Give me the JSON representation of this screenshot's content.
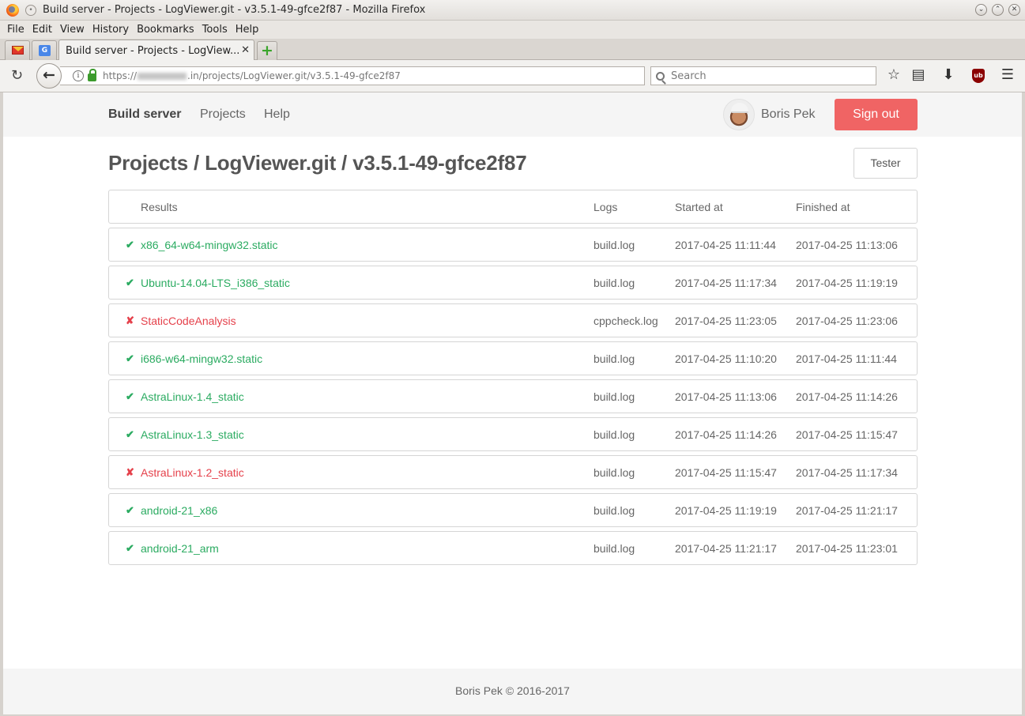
{
  "window": {
    "title": "Build server - Projects - LogViewer.git - v3.5.1-49-gfce2f87 - Mozilla Firefox"
  },
  "menu": [
    "File",
    "Edit",
    "View",
    "History",
    "Bookmarks",
    "Tools",
    "Help"
  ],
  "tabs": {
    "active_title": "Build server - Projects - LogView...",
    "close_glyph": "✕",
    "new_tab_glyph": "+"
  },
  "urlbar": {
    "prefix": "https://",
    "suffix": ".in/projects/LogViewer.git/v3.5.1-49-gfce2f87"
  },
  "search": {
    "placeholder": "Search"
  },
  "site": {
    "brand": "Build server",
    "nav": [
      "Projects",
      "Help"
    ],
    "user": "Boris Pek",
    "signout_label": "Sign out"
  },
  "page": {
    "title": "Projects / LogViewer.git / v3.5.1-49-gfce2f87",
    "tester_label": "Tester"
  },
  "table": {
    "headers": [
      "Results",
      "Logs",
      "Started at",
      "Finished at"
    ],
    "rows": [
      {
        "status": "ok",
        "mark": "✔",
        "name": "x86_64-w64-mingw32.static",
        "log": "build.log",
        "started": "2017-04-25 11:11:44",
        "finished": "2017-04-25 11:13:06"
      },
      {
        "status": "ok",
        "mark": "✔",
        "name": "Ubuntu-14.04-LTS_i386_static",
        "log": "build.log",
        "started": "2017-04-25 11:17:34",
        "finished": "2017-04-25 11:19:19"
      },
      {
        "status": "fail",
        "mark": "✘",
        "name": "StaticCodeAnalysis",
        "log": "cppcheck.log",
        "started": "2017-04-25 11:23:05",
        "finished": "2017-04-25 11:23:06"
      },
      {
        "status": "ok",
        "mark": "✔",
        "name": "i686-w64-mingw32.static",
        "log": "build.log",
        "started": "2017-04-25 11:10:20",
        "finished": "2017-04-25 11:11:44"
      },
      {
        "status": "ok",
        "mark": "✔",
        "name": "AstraLinux-1.4_static",
        "log": "build.log",
        "started": "2017-04-25 11:13:06",
        "finished": "2017-04-25 11:14:26"
      },
      {
        "status": "ok",
        "mark": "✔",
        "name": "AstraLinux-1.3_static",
        "log": "build.log",
        "started": "2017-04-25 11:14:26",
        "finished": "2017-04-25 11:15:47"
      },
      {
        "status": "fail",
        "mark": "✘",
        "name": "AstraLinux-1.2_static",
        "log": "build.log",
        "started": "2017-04-25 11:15:47",
        "finished": "2017-04-25 11:17:34"
      },
      {
        "status": "ok",
        "mark": "✔",
        "name": "android-21_x86",
        "log": "build.log",
        "started": "2017-04-25 11:19:19",
        "finished": "2017-04-25 11:21:17"
      },
      {
        "status": "ok",
        "mark": "✔",
        "name": "android-21_arm",
        "log": "build.log",
        "started": "2017-04-25 11:21:17",
        "finished": "2017-04-25 11:23:01"
      }
    ]
  },
  "footer": {
    "text": "Boris Pek © 2016-2017"
  },
  "colors": {
    "ok": "#2bab61",
    "fail": "#e5414b",
    "signout": "#f06464"
  }
}
